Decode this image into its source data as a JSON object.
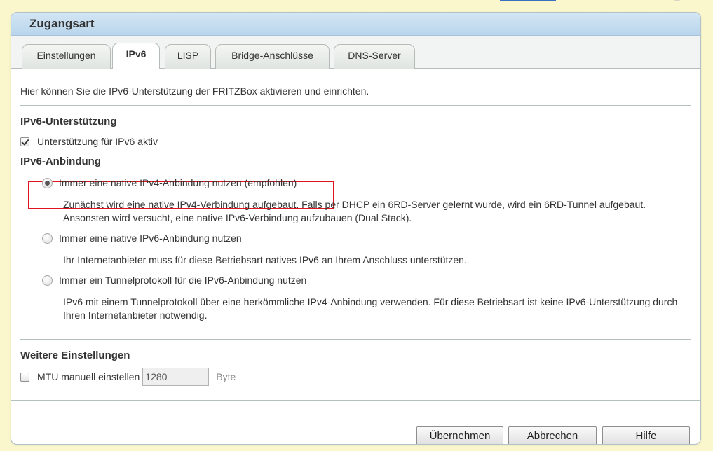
{
  "panel": {
    "title": "Zugangsart"
  },
  "tabs": [
    {
      "label": "Einstellungen",
      "active": false
    },
    {
      "label": "IPv6",
      "active": true
    },
    {
      "label": "LISP",
      "active": false
    },
    {
      "label": "Bridge-Anschlüsse",
      "active": false
    },
    {
      "label": "DNS-Server",
      "active": false
    }
  ],
  "intro": "Hier können Sie die IPv6-Unterstützung der FRITZBox aktivieren und einrichten.",
  "support": {
    "heading": "IPv6-Unterstützung",
    "checkbox_label": "Unterstützung für IPv6 aktiv",
    "checked": true
  },
  "binding": {
    "heading": "IPv6-Anbindung",
    "options": [
      {
        "label": "Immer eine native IPv4-Anbindung nutzen (empfohlen)",
        "checked": true,
        "description": "Zunächst wird eine native IPv4-Verbindung aufgebaut. Falls per DHCP ein 6RD-Server gelernt wurde, wird ein 6RD-Tunnel aufgebaut. Ansonsten wird versucht, eine native IPv6-Verbindung aufzubauen (Dual Stack)."
      },
      {
        "label": "Immer eine native IPv6-Anbindung nutzen",
        "checked": false,
        "description": "Ihr Internetanbieter muss für diese Betriebsart natives IPv6 an Ihrem Anschluss unterstützen."
      },
      {
        "label": "Immer ein Tunnelprotokoll für die IPv6-Anbindung nutzen",
        "checked": false,
        "description": "IPv6 mit einem Tunnelprotokoll über eine herkömmliche IPv4-Anbindung verwenden. Für diese Betriebsart ist keine IPv6-Unterstützung durch Ihren Internetanbieter notwendig."
      }
    ]
  },
  "further": {
    "heading": "Weitere Einstellungen",
    "mtu_label": "MTU manuell einstellen",
    "mtu_checked": false,
    "mtu_value": "1280",
    "mtu_unit": "Byte"
  },
  "buttons": {
    "apply": "Übernehmen",
    "cancel": "Abbrechen",
    "help": "Hilfe"
  },
  "colors": {
    "page_background": "#fbf7cc",
    "header_gradient": "#c7def1",
    "highlight_box": "#e0141e"
  }
}
